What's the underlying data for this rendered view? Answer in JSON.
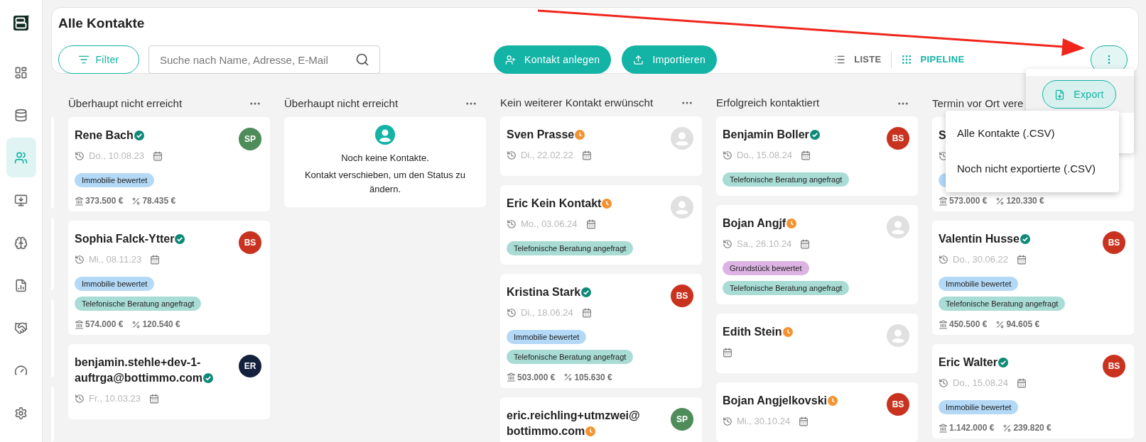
{
  "sidebar": {
    "items": [
      {
        "selected": false
      },
      {
        "selected": false
      },
      {
        "selected": true
      },
      {
        "selected": false
      },
      {
        "selected": false
      },
      {
        "selected": false
      },
      {
        "selected": false
      },
      {
        "selected": false
      },
      {
        "selected": false
      }
    ]
  },
  "header": {
    "title": "Alle Kontakte",
    "filter_button": "Filter",
    "search": {
      "placeholder": "Suche nach Name, Adresse, E-Mail"
    },
    "buttons": [
      "Kontakt anlegen",
      "Importieren"
    ],
    "views": [
      {
        "label": "LISTE",
        "selected": false
      },
      {
        "label": "PIPELINE",
        "selected": true
      }
    ]
  },
  "columns": [
    {
      "title": "Überhaupt nicht erreicht",
      "cards": [
        {
          "name": "Rene Bach",
          "verified": true,
          "avatar": {
            "kind": "initials",
            "initials": "SP",
            "color": "#4e8c5a"
          },
          "date": "Do., 10.08.23",
          "tags": [
            {
              "label": "Immobilie bewertet",
              "color": "#b3d9f7"
            }
          ],
          "price": "373.500 €",
          "commission": "78.435 €"
        },
        {
          "name": "Sophia Falck-Ytter",
          "verified": true,
          "avatar": {
            "kind": "initials",
            "initials": "BS",
            "color": "#c9321f"
          },
          "date": "Mi., 08.11.23",
          "tags": [
            {
              "label": "Immobilie bewertet",
              "color": "#b3d9f7"
            },
            {
              "label": "Telefonische Beratung angefragt",
              "color": "#a8dcd5"
            }
          ],
          "price": "574.000 €",
          "commission": "120.540 €"
        },
        {
          "name": "benjamin.stehle+dev-1-auftrga@bottimmo.com",
          "verified": true,
          "avatar": {
            "kind": "initials",
            "initials": "ER",
            "color": "#14213d"
          },
          "date": "Fr., 10.03.23"
        }
      ]
    },
    {
      "title": "Überhaupt nicht erreicht",
      "empty": {
        "title": "Noch keine Kontakte.",
        "text": "Kontakt verschieben, um den Status zu ändern."
      }
    },
    {
      "title": "Kein weiterer Kontakt erwünscht",
      "cards": [
        {
          "name": "Sven Prasse",
          "verified": false,
          "avatar": {
            "kind": "placeholder"
          },
          "date": "Di., 22.02.22"
        },
        {
          "name": "Eric Kein Kontakt",
          "verified": false,
          "avatar": {
            "kind": "placeholder"
          },
          "date": "Mo., 03.06.24",
          "tags": [
            {
              "label": "Telefonische Beratung angefragt",
              "color": "#a8dcd5"
            }
          ]
        },
        {
          "name": "Kristina Stark",
          "verified": true,
          "avatar": {
            "kind": "initials",
            "initials": "BS",
            "color": "#c9321f"
          },
          "date": "Di., 18.06.24",
          "tags": [
            {
              "label": "Immobilie bewertet",
              "color": "#b3d9f7"
            },
            {
              "label": "Telefonische Beratung angefragt",
              "color": "#a8dcd5"
            }
          ],
          "price": "503.000 €",
          "commission": "105.630 €"
        },
        {
          "name": "eric.reichling+utmzwei@bottimmo.com",
          "verified": false,
          "avatar": {
            "kind": "initials",
            "initials": "SP",
            "color": "#4e8c5a"
          }
        }
      ]
    },
    {
      "title": "Erfolgreich kontaktiert",
      "cards": [
        {
          "name": "Benjamin Boller",
          "verified": true,
          "avatar": {
            "kind": "initials",
            "initials": "BS",
            "color": "#c9321f"
          },
          "date": "Do., 15.08.24",
          "tags": [
            {
              "label": "Telefonische Beratung angefragt",
              "color": "#a8dcd5"
            }
          ]
        },
        {
          "name": "Bojan Angjf",
          "verified": false,
          "avatar": {
            "kind": "placeholder"
          },
          "date": "Sa., 26.10.24",
          "tags": [
            {
              "label": "Grundstück bewertet",
              "color": "#dcb3e3"
            },
            {
              "label": "Telefonische Beratung angefragt",
              "color": "#a8dcd5"
            }
          ]
        },
        {
          "name": "Edith Stein",
          "verified": false,
          "avatar": {
            "kind": "placeholder"
          },
          "calendar": true
        },
        {
          "name": "Bojan Angjelkovski",
          "verified": false,
          "avatar": {
            "kind": "initials",
            "initials": "BS",
            "color": "#c9321f"
          },
          "date": "Mi., 30.10.24"
        }
      ]
    },
    {
      "title": "Termin vor Ort vere",
      "cards": [
        {
          "name": "S",
          "covered": true,
          "price": "573.000 €",
          "commission": "120.330 €"
        },
        {
          "name": "Valentin Husse",
          "verified": true,
          "avatar": {
            "kind": "initials",
            "initials": "BS",
            "color": "#c9321f"
          },
          "date": "Do., 30.06.22",
          "tags": [
            {
              "label": "Immobilie bewertet",
              "color": "#b3d9f7"
            },
            {
              "label": "Telefonische Beratung angefragt",
              "color": "#a8dcd5"
            }
          ],
          "price": "450.500 €",
          "commission": "94.605 €"
        },
        {
          "name": "Eric Walter",
          "verified": true,
          "avatar": {
            "kind": "initials",
            "initials": "BS",
            "color": "#c9321f"
          },
          "date": "Do., 15.08.24",
          "tags": [
            {
              "label": "Immobilie bewertet",
              "color": "#b3d9f7"
            }
          ],
          "price": "1.142.000 €",
          "commission": "239.820 €"
        }
      ]
    }
  ],
  "menu": {
    "export_button": "Export",
    "items": [
      "Alle Kontakte (.CSV)",
      "Noch nicht exportierte (.CSV)"
    ]
  }
}
